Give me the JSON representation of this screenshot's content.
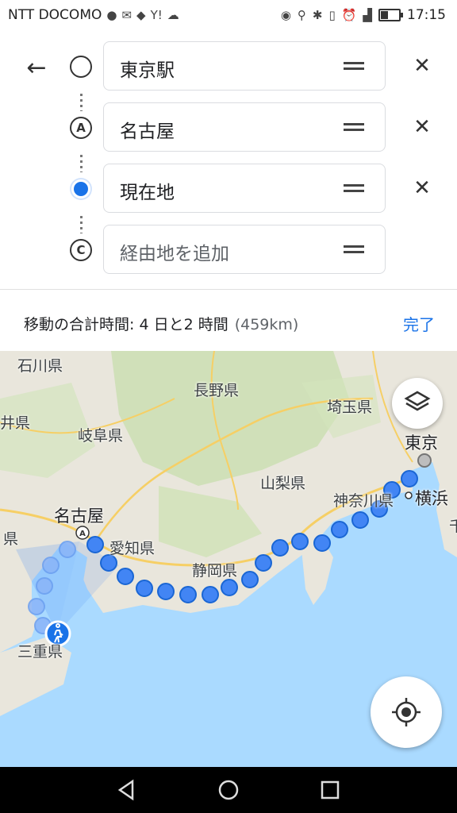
{
  "status_bar": {
    "carrier": "NTT DOCOMO",
    "time": "17:15",
    "icons": [
      "line-icon",
      "mail-icon",
      "twitter-icon",
      "yahoo-icon",
      "cloud-icon",
      "nfc-icon",
      "location-icon",
      "bluetooth-icon",
      "vibrate-icon",
      "alarm-icon",
      "signal-icon",
      "battery-icon"
    ]
  },
  "route": {
    "stops": [
      {
        "marker": "origin",
        "text": "東京駅"
      },
      {
        "marker": "A",
        "text": "名古屋"
      },
      {
        "marker": "current",
        "text": "現在地"
      },
      {
        "marker": "C",
        "placeholder": "経由地を追加"
      }
    ],
    "summary": "移動の合計時間: 4 日と2 時間",
    "distance": "(459km)",
    "done_label": "完了"
  },
  "map": {
    "labels": [
      "石川県",
      "井県",
      "岐阜県",
      "長野県",
      "埼玉県",
      "東京",
      "山梨県",
      "神奈川県",
      "横浜",
      "名古屋",
      "愛知県",
      "静岡県",
      "三重県",
      "県",
      "千"
    ],
    "colors": {
      "land": "#e9e6dc",
      "sea": "#aadaff",
      "green": "#c9dfb0",
      "route": "#4285f4",
      "route_edge": "#1a66d4",
      "road": "#f6cf65"
    }
  },
  "nav": {
    "icons": [
      "back-triangle-icon",
      "home-circle-icon",
      "recents-square-icon"
    ]
  }
}
